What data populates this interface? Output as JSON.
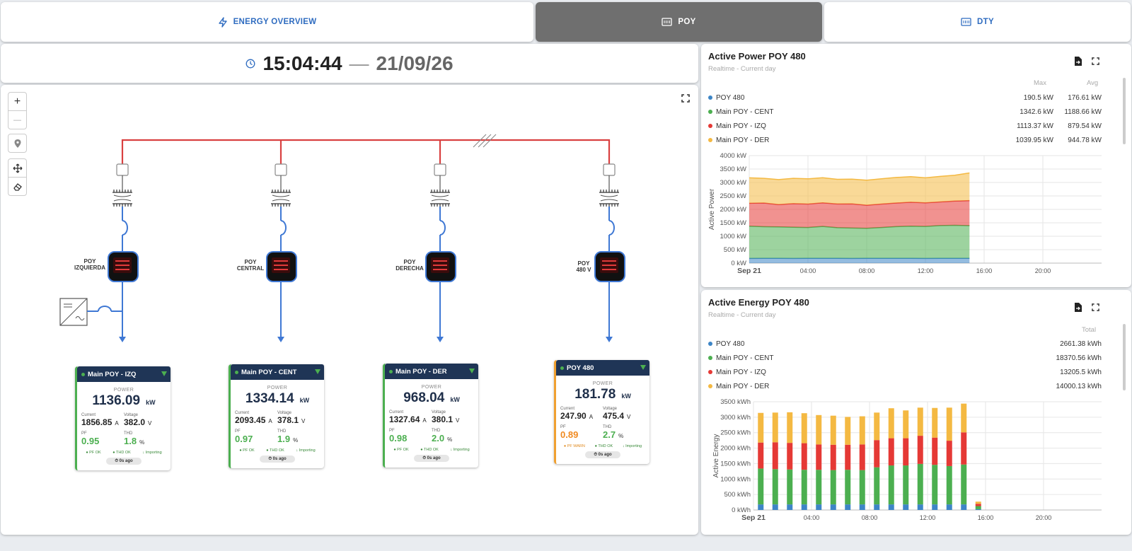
{
  "tabs": [
    {
      "label": "ENERGY OVERVIEW",
      "icon": "bolt-icon",
      "active": false
    },
    {
      "label": "POY",
      "icon": "meter-icon",
      "active": true
    },
    {
      "label": "DTY",
      "icon": "meter-icon",
      "active": false
    }
  ],
  "clock": {
    "time": "15:04:44",
    "separator": "—",
    "date": "21/09/26"
  },
  "map_controls": {
    "zoom_in": "+",
    "zoom_out": "—"
  },
  "diagram": {
    "feeders": [
      {
        "name_line1": "POY",
        "name_line2": "IZQUIERDA"
      },
      {
        "name_line1": "POY",
        "name_line2": "CENTRAL"
      },
      {
        "name_line1": "POY",
        "name_line2": "DERECHA"
      },
      {
        "name_line1": "POY",
        "name_line2": "480 V"
      }
    ]
  },
  "cards": [
    {
      "title": "Main POY - IZQ",
      "power_label": "POWER",
      "power": "1136.09",
      "power_unit": "kW",
      "current_label": "Current",
      "current": "1856.85",
      "current_unit": "A",
      "voltage_label": "Voltage",
      "voltage": "382.0",
      "voltage_unit": "V",
      "pf_label": "PF",
      "pf": "0.95",
      "thd_label": "THD",
      "thd": "1.8",
      "thd_unit": "%",
      "s1": "● PF OK",
      "s2": "● THD OK",
      "s3": "↓ Importing",
      "ago": "⏱ 0s ago"
    },
    {
      "title": "Main POY - CENT",
      "power_label": "POWER",
      "power": "1334.14",
      "power_unit": "kW",
      "current_label": "Current",
      "current": "2093.45",
      "current_unit": "A",
      "voltage_label": "Voltage",
      "voltage": "378.1",
      "voltage_unit": "V",
      "pf_label": "PF",
      "pf": "0.97",
      "thd_label": "THD",
      "thd": "1.9",
      "thd_unit": "%",
      "s1": "● PF OK",
      "s2": "● THD OK",
      "s3": "↓ Importing",
      "ago": "⏱ 0s ago"
    },
    {
      "title": "Main POY - DER",
      "power_label": "POWER",
      "power": "968.04",
      "power_unit": "kW",
      "current_label": "Current",
      "current": "1327.64",
      "current_unit": "A",
      "voltage_label": "Voltage",
      "voltage": "380.1",
      "voltage_unit": "V",
      "pf_label": "PF",
      "pf": "0.98",
      "thd_label": "THD",
      "thd": "2.0",
      "thd_unit": "%",
      "s1": "● PF OK",
      "s2": "● THD OK",
      "s3": "↓ Importing",
      "ago": "⏱ 0s ago"
    },
    {
      "title": "POY 480",
      "power_label": "POWER",
      "power": "181.78",
      "power_unit": "kW",
      "current_label": "Current",
      "current": "247.90",
      "current_unit": "A",
      "voltage_label": "Voltage",
      "voltage": "475.4",
      "voltage_unit": "V",
      "pf_label": "PF",
      "pf": "0.89",
      "thd_label": "THD",
      "thd": "2.7",
      "thd_unit": "%",
      "s1": "● PF WARN",
      "s2": "● THD OK",
      "s3": "↓ Importing",
      "ago": "⏱ 0s ago"
    }
  ],
  "power_chart": {
    "title": "Active Power POY 480",
    "subtitle": "Realtime - Current day",
    "col_max": "Max",
    "col_avg": "Avg",
    "legend": [
      {
        "name": "POY 480",
        "color": "#3d85c6",
        "max": "190.5 kW",
        "avg": "176.61 kW"
      },
      {
        "name": "Main POY - CENT",
        "color": "#4caf50",
        "max": "1342.6 kW",
        "avg": "1188.66 kW"
      },
      {
        "name": "Main POY - IZQ",
        "color": "#e53935",
        "max": "1113.37 kW",
        "avg": "879.54 kW"
      },
      {
        "name": "Main POY - DER",
        "color": "#f4b942",
        "max": "1039.95 kW",
        "avg": "944.78 kW"
      }
    ]
  },
  "energy_chart": {
    "title": "Active Energy POY 480",
    "subtitle": "Realtime - Current day",
    "col_total": "Total",
    "legend": [
      {
        "name": "POY 480",
        "color": "#3d85c6",
        "total": "2661.38 kWh"
      },
      {
        "name": "Main POY - CENT",
        "color": "#4caf50",
        "total": "18370.56 kWh"
      },
      {
        "name": "Main POY - IZQ",
        "color": "#e53935",
        "total": "13205.5 kWh"
      },
      {
        "name": "Main POY - DER",
        "color": "#f4b942",
        "total": "14000.13 kWh"
      }
    ]
  },
  "chart_data": [
    {
      "type": "area",
      "title": "Active Power POY 480",
      "subtitle": "Realtime - Current day",
      "ylabel": "Active Power",
      "ylim": [
        0,
        4000
      ],
      "y_ticks": [
        "0 kW",
        "500 kW",
        "1000 kW",
        "1500 kW",
        "2000 kW",
        "2500 kW",
        "3000 kW",
        "3500 kW",
        "4000 kW"
      ],
      "x_ticks": [
        "Sep 21",
        "04:00",
        "08:00",
        "12:00",
        "16:00",
        "20:00"
      ],
      "x_hours": [
        0,
        24
      ],
      "stacked": true,
      "x": [
        0,
        1,
        2,
        3,
        4,
        5,
        6,
        7,
        8,
        9,
        10,
        11,
        12,
        13,
        14,
        15
      ],
      "series": [
        {
          "name": "POY 480",
          "color": "#3d85c6",
          "values": [
            175,
            176,
            178,
            174,
            177,
            176,
            179,
            175,
            176,
            177,
            178,
            176,
            175,
            177,
            178,
            176
          ]
        },
        {
          "name": "Main POY - CENT",
          "color": "#4caf50",
          "values": [
            1200,
            1180,
            1170,
            1160,
            1150,
            1190,
            1140,
            1130,
            1120,
            1150,
            1180,
            1200,
            1190,
            1220,
            1230,
            1220
          ]
        },
        {
          "name": "Main POY - IZQ",
          "color": "#e53935",
          "values": [
            850,
            880,
            830,
            880,
            870,
            880,
            880,
            900,
            860,
            870,
            880,
            890,
            880,
            880,
            900,
            930
          ]
        },
        {
          "name": "Main POY - DER",
          "color": "#f4b942",
          "values": [
            950,
            920,
            930,
            940,
            940,
            930,
            920,
            920,
            930,
            940,
            950,
            950,
            930,
            950,
            960,
            1030
          ]
        }
      ]
    },
    {
      "type": "bar",
      "title": "Active Energy POY 480",
      "subtitle": "Realtime - Current day",
      "ylabel": "Active Energy",
      "ylim": [
        0,
        3500
      ],
      "y_ticks": [
        "0 kWh",
        "500 kWh",
        "1000 kWh",
        "1500 kWh",
        "2000 kWh",
        "2500 kWh",
        "3000 kWh",
        "3500 kWh"
      ],
      "x_ticks": [
        "Sep 21",
        "04:00",
        "08:00",
        "12:00",
        "16:00",
        "20:00"
      ],
      "x_hours": [
        0,
        24
      ],
      "stacked": true,
      "x": [
        0,
        1,
        2,
        3,
        4,
        5,
        6,
        7,
        8,
        9,
        10,
        11,
        12,
        13,
        14,
        15
      ],
      "series": [
        {
          "name": "POY 480",
          "color": "#3d85c6",
          "values": [
            180,
            180,
            180,
            180,
            180,
            180,
            180,
            180,
            180,
            180,
            180,
            180,
            180,
            180,
            180,
            25
          ]
        },
        {
          "name": "Main POY - CENT",
          "color": "#4caf50",
          "values": [
            1160,
            1140,
            1130,
            1120,
            1120,
            1110,
            1120,
            1110,
            1200,
            1260,
            1260,
            1310,
            1280,
            1240,
            1290,
            100
          ]
        },
        {
          "name": "Main POY - IZQ",
          "color": "#e53935",
          "values": [
            840,
            870,
            860,
            860,
            820,
            820,
            810,
            830,
            880,
            880,
            880,
            910,
            880,
            820,
            1040,
            75
          ]
        },
        {
          "name": "Main POY - DER",
          "color": "#f4b942",
          "values": [
            960,
            960,
            990,
            970,
            950,
            940,
            900,
            910,
            890,
            970,
            900,
            910,
            960,
            1070,
            930,
            70
          ]
        }
      ]
    }
  ]
}
